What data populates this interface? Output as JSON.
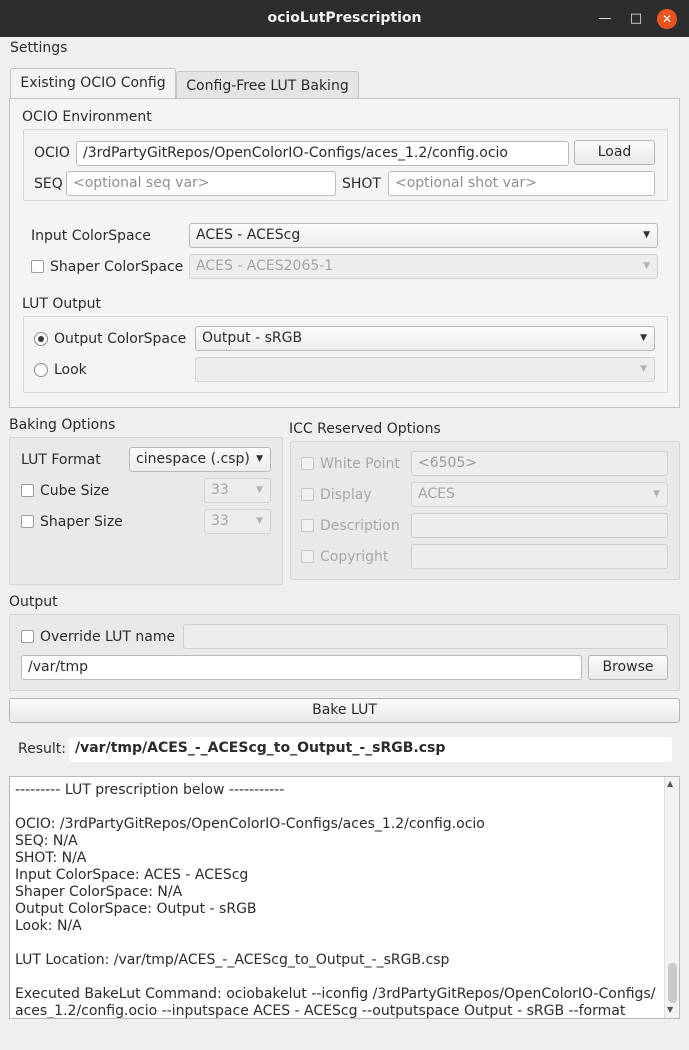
{
  "window": {
    "title": "ocioLutPrescription"
  },
  "menu": {
    "settings": "Settings"
  },
  "tabs": [
    {
      "label": "Existing OCIO Config",
      "active": true
    },
    {
      "label": "Config-Free LUT Baking",
      "active": false
    }
  ],
  "ocio_env": {
    "title": "OCIO Environment",
    "ocio_label": "OCIO",
    "ocio_value": "/3rdPartyGitRepos/OpenColorIO-Configs/aces_1.2/config.ocio",
    "load_label": "Load",
    "seq_label": "SEQ",
    "seq_placeholder": "<optional seq var>",
    "shot_label": "SHOT",
    "shot_placeholder": "<optional shot var>"
  },
  "colorspaces": {
    "input_label": "Input ColorSpace",
    "input_value": "ACES - ACEScg",
    "shaper_label": "Shaper ColorSpace",
    "shaper_value": "ACES - ACES2065-1"
  },
  "lut_output": {
    "title": "LUT Output",
    "output_cs_label": "Output ColorSpace",
    "output_cs_value": "Output - sRGB",
    "look_label": "Look",
    "look_value": ""
  },
  "baking": {
    "title": "Baking Options",
    "lut_format_label": "LUT Format",
    "lut_format_value": "cinespace (.csp)",
    "cube_size_label": "Cube Size",
    "cube_size_value": "33",
    "shaper_size_label": "Shaper Size",
    "shaper_size_value": "33"
  },
  "icc": {
    "title": "ICC Reserved Options",
    "white_point_label": "White Point",
    "white_point_value": "<6505>",
    "display_label": "Display",
    "display_value": "ACES",
    "description_label": "Description",
    "copyright_label": "Copyright"
  },
  "output": {
    "title": "Output",
    "override_label": "Override LUT name",
    "path_value": "/var/tmp",
    "browse_label": "Browse"
  },
  "bake_label": "Bake LUT",
  "result": {
    "label": "Result:",
    "value": "/var/tmp/ACES_-_ACEScg_to_Output_-_sRGB.csp"
  },
  "log": {
    "text": "--------- LUT prescription below -----------\n\nOCIO: /3rdPartyGitRepos/OpenColorIO-Configs/aces_1.2/config.ocio\nSEQ: N/A\nSHOT: N/A\nInput ColorSpace: ACES - ACEScg\nShaper ColorSpace: N/A\nOutput ColorSpace: Output - sRGB\nLook: N/A\n\nLUT Location: /var/tmp/ACES_-_ACEScg_to_Output_-_sRGB.csp\n\nExecuted BakeLut Command: ociobakelut --iconfig /3rdPartyGitRepos/OpenColorIO-Configs/aces_1.2/config.ocio --inputspace ACES - ACEScg --outputspace Output - sRGB --format"
  },
  "colors": {
    "titlebar": "#2d2d2d",
    "close_button": "#e95420",
    "window_bg": "#efefef"
  },
  "icons": [
    "minimize-icon",
    "maximize-icon",
    "close-icon",
    "chevron-down-icon",
    "scroll-up-icon",
    "scroll-down-icon"
  ]
}
